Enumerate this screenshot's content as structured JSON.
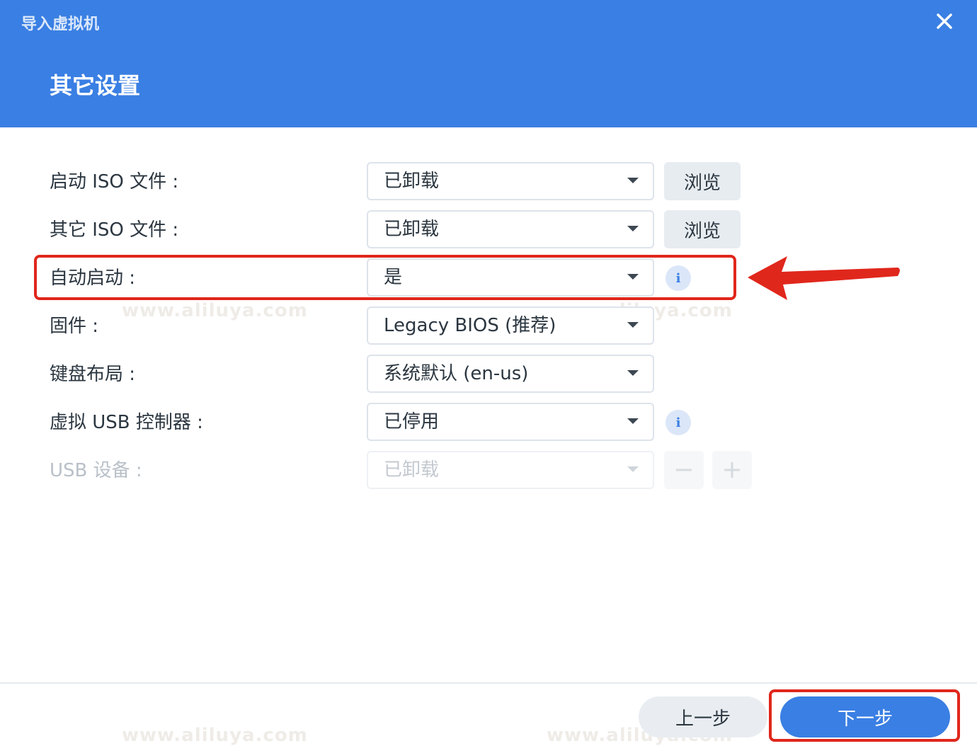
{
  "window": {
    "title": "导入虚拟机"
  },
  "page": {
    "heading": "其它设置"
  },
  "rows": [
    {
      "label": "启动 ISO 文件 :",
      "value": "已卸载",
      "action": "浏览"
    },
    {
      "label": "其它 ISO 文件 :",
      "value": "已卸载",
      "action": "浏览"
    },
    {
      "label": "自动启动 :",
      "value": "是"
    },
    {
      "label": "固件 :",
      "value": "Legacy BIOS (推荐)"
    },
    {
      "label": "键盘布局 :",
      "value": "系统默认 (en-us)"
    },
    {
      "label": "虚拟 USB 控制器 :",
      "value": "已停用"
    },
    {
      "label": "USB 设备 :",
      "value": "已卸载"
    }
  ],
  "footer": {
    "prev_label": "上一步",
    "next_label": "下一步"
  },
  "watermark": {
    "text": "www.aliluya.com"
  },
  "colors": {
    "accent": "#3a7fe3",
    "annotation": "#e0271c"
  }
}
